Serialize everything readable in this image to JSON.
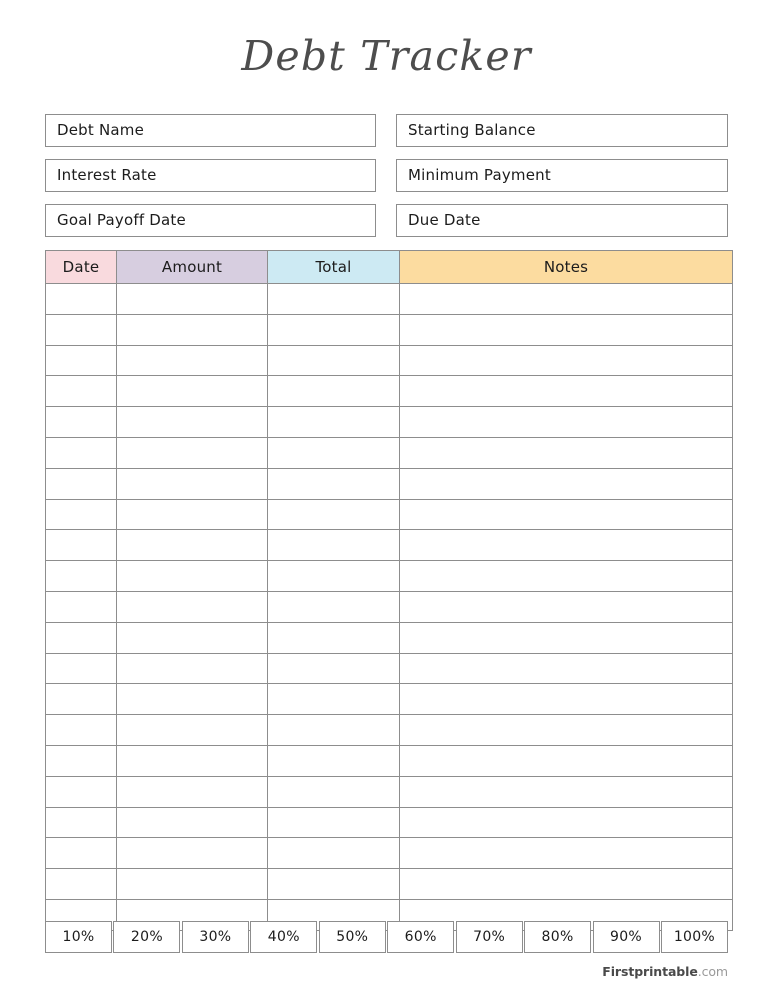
{
  "page": {
    "title": "Debt Tracker"
  },
  "info_fields": {
    "rows": [
      {
        "left": "Debt Name",
        "right": "Starting Balance"
      },
      {
        "left": "Interest Rate",
        "right": "Minimum Payment"
      },
      {
        "left": "Goal Payoff Date",
        "right": "Due Date"
      }
    ]
  },
  "table": {
    "columns": [
      {
        "label": "Date",
        "color": "#f9dade"
      },
      {
        "label": "Amount",
        "color": "#d7cee0"
      },
      {
        "label": "Total",
        "color": "#cdeaf3"
      },
      {
        "label": "Notes",
        "color": "#fcdca0"
      }
    ],
    "row_count": 21,
    "rows": [
      {
        "date": "",
        "amount": "",
        "total": "",
        "notes": ""
      },
      {
        "date": "",
        "amount": "",
        "total": "",
        "notes": ""
      },
      {
        "date": "",
        "amount": "",
        "total": "",
        "notes": ""
      },
      {
        "date": "",
        "amount": "",
        "total": "",
        "notes": ""
      },
      {
        "date": "",
        "amount": "",
        "total": "",
        "notes": ""
      },
      {
        "date": "",
        "amount": "",
        "total": "",
        "notes": ""
      },
      {
        "date": "",
        "amount": "",
        "total": "",
        "notes": ""
      },
      {
        "date": "",
        "amount": "",
        "total": "",
        "notes": ""
      },
      {
        "date": "",
        "amount": "",
        "total": "",
        "notes": ""
      },
      {
        "date": "",
        "amount": "",
        "total": "",
        "notes": ""
      },
      {
        "date": "",
        "amount": "",
        "total": "",
        "notes": ""
      },
      {
        "date": "",
        "amount": "",
        "total": "",
        "notes": ""
      },
      {
        "date": "",
        "amount": "",
        "total": "",
        "notes": ""
      },
      {
        "date": "",
        "amount": "",
        "total": "",
        "notes": ""
      },
      {
        "date": "",
        "amount": "",
        "total": "",
        "notes": ""
      },
      {
        "date": "",
        "amount": "",
        "total": "",
        "notes": ""
      },
      {
        "date": "",
        "amount": "",
        "total": "",
        "notes": ""
      },
      {
        "date": "",
        "amount": "",
        "total": "",
        "notes": ""
      },
      {
        "date": "",
        "amount": "",
        "total": "",
        "notes": ""
      },
      {
        "date": "",
        "amount": "",
        "total": "",
        "notes": ""
      },
      {
        "date": "",
        "amount": "",
        "total": "",
        "notes": ""
      }
    ]
  },
  "progress_markers": {
    "items": [
      "10%",
      "20%",
      "30%",
      "40%",
      "50%",
      "60%",
      "70%",
      "80%",
      "90%",
      "100%"
    ]
  },
  "footer": {
    "brand": "Firstprintable",
    "tld": ".com"
  },
  "colors": {
    "border": "#8d8d8d",
    "text": "#1c1c1c",
    "title": "#4d4d4d",
    "header_date": "#f9dade",
    "header_amount": "#d7cee0",
    "header_total": "#cdeaf3",
    "header_notes": "#fcdca0",
    "footer_brand": "#4a4a4a",
    "footer_tld": "#9a9a9a"
  }
}
